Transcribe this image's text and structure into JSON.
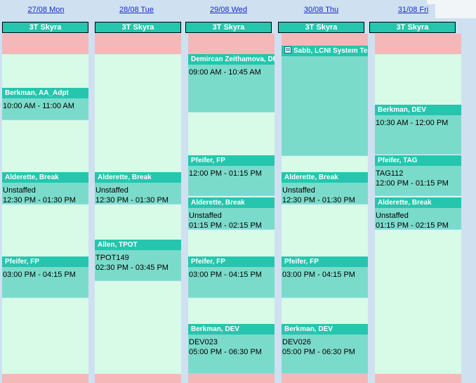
{
  "days": [
    {
      "date": "27/08 Mon",
      "resource": "3T Skyra",
      "appointments": [
        {
          "title": "Berkman, AA_Adpt",
          "lines": [
            "10:00 AM - 11:00 AM"
          ]
        },
        {
          "title": "Alderette, Break",
          "lines": [
            "Unstaffed",
            "12:30 PM - 01:30 PM"
          ]
        },
        {
          "title": "Pfeifer, FP",
          "lines": [
            "03:00 PM - 04:15 PM"
          ]
        }
      ]
    },
    {
      "date": "28/08 Tue",
      "resource": "3T Skyra",
      "appointments": [
        {
          "title": "Alderette, Break",
          "lines": [
            "Unstaffed",
            "12:30 PM - 01:30 PM"
          ]
        },
        {
          "title": "Allen, TPOT",
          "lines": [
            "TPOT149",
            "02:30 PM - 03:45 PM"
          ]
        }
      ]
    },
    {
      "date": "29/08 Wed",
      "resource": "3T Skyra",
      "appointments": [
        {
          "title": "Demircan Zeithamova, DICA",
          "lines": [
            "09:00 AM - 10:45 AM"
          ]
        },
        {
          "title": "Pfeifer, FP",
          "lines": [
            "12:00 PM - 01:15 PM"
          ]
        },
        {
          "title": "Alderette, Break",
          "lines": [
            "Unstaffed",
            "01:15 PM - 02:15 PM"
          ]
        },
        {
          "title": "Pfeifer, FP",
          "lines": [
            "03:00 PM - 04:15 PM"
          ]
        },
        {
          "title": "Berkman, DEV",
          "lines": [
            "DEV023",
            "05:00 PM - 06:30 PM"
          ]
        }
      ]
    },
    {
      "date": "30/08 Thu",
      "resource": "3T Skyra",
      "appointments": [
        {
          "title": "Sabb, LCNI System Test",
          "lines": [],
          "icon": "note-icon"
        },
        {
          "title": "Alderette, Break",
          "lines": [
            "Unstaffed",
            "12:30 PM - 01:30 PM"
          ]
        },
        {
          "title": "Pfeifer, FP",
          "lines": [
            "03:00 PM - 04:15 PM"
          ]
        },
        {
          "title": "Berkman, DEV",
          "lines": [
            "DEV026",
            "05:00 PM - 06:30 PM"
          ]
        }
      ]
    },
    {
      "date": "31/08 Fri",
      "resource": "3T Skyra",
      "appointments": [
        {
          "title": "Berkman, DEV",
          "lines": [
            "10:30 AM - 12:00 PM"
          ]
        },
        {
          "title": "Pfeifer, TAG",
          "lines": [
            "TAG112",
            "12:00 PM - 01:15 PM"
          ]
        },
        {
          "title": "Alderette, Break",
          "lines": [
            "Unstaffed",
            "01:15 PM - 02:15 PM"
          ]
        }
      ]
    }
  ]
}
